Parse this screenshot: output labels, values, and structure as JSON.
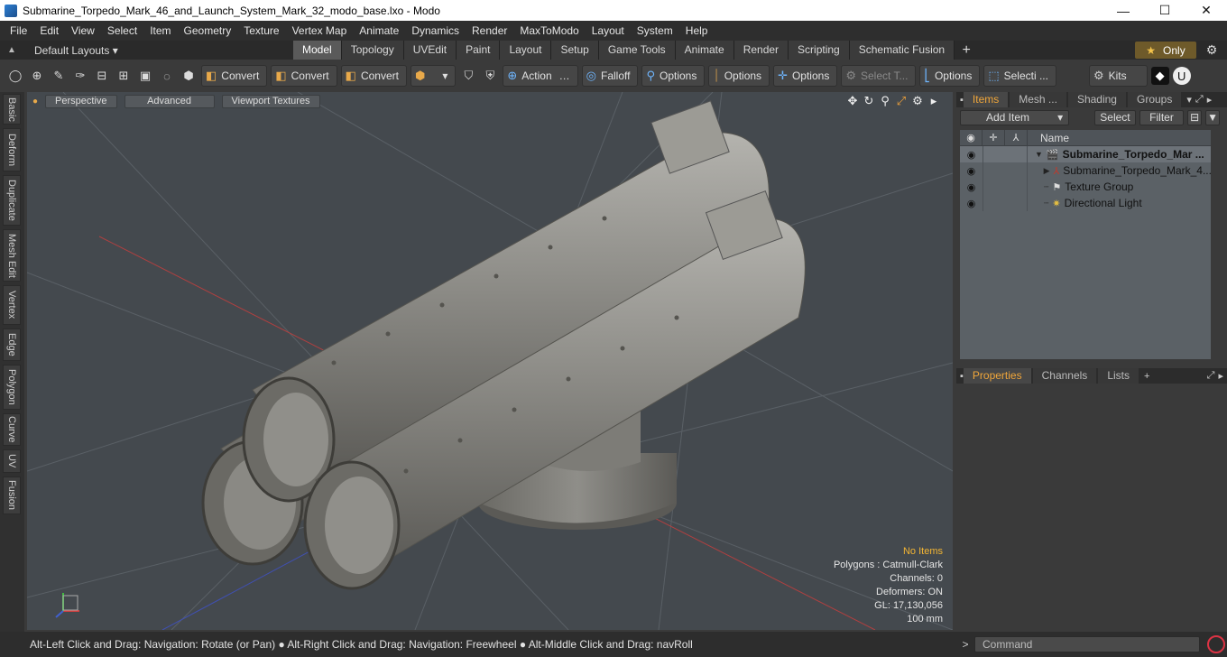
{
  "window": {
    "title": "Submarine_Torpedo_Mark_46_and_Launch_System_Mark_32_modo_base.lxo - Modo",
    "minimize": "—",
    "maximize": "☐",
    "close": "✕"
  },
  "menu": [
    "File",
    "Edit",
    "View",
    "Select",
    "Item",
    "Geometry",
    "Texture",
    "Vertex Map",
    "Animate",
    "Dynamics",
    "Render",
    "MaxToModo",
    "Layout",
    "System",
    "Help"
  ],
  "layouts": {
    "dropdown": "Default Layouts ▾",
    "tabs": [
      "Model",
      "Topology",
      "UVEdit",
      "Paint",
      "Layout",
      "Setup",
      "Game Tools",
      "Animate",
      "Render",
      "Scripting",
      "Schematic Fusion"
    ],
    "active": "Model",
    "only": "Only"
  },
  "toolbar": {
    "convert1": "Convert",
    "convert2": "Convert",
    "convert3": "Convert",
    "action": "Action",
    "falloff": "Falloff",
    "options1": "Options",
    "options2": "Options",
    "options3": "Options",
    "select_t": "Select T...",
    "options4": "Options",
    "selecti": "Selecti ...",
    "kits": "Kits"
  },
  "left_tabs": [
    "Basic",
    "Deform",
    "Duplicate",
    "Mesh Edit",
    "Vertex",
    "Edge",
    "Polygon",
    "Curve",
    "UV",
    "Fusion"
  ],
  "viewport": {
    "perspective": "Perspective",
    "advanced": "Advanced",
    "textures": "Viewport Textures",
    "stats": {
      "no_items": "No Items",
      "polygons": "Polygons : Catmull-Clark",
      "channels": "Channels: 0",
      "deformers": "Deformers: ON",
      "gl": "GL: 17,130,056",
      "scale": "100 mm"
    }
  },
  "items_panel": {
    "tabs": [
      "Items",
      "Mesh ...",
      "Shading",
      "Groups"
    ],
    "add_item": "Add Item",
    "select": "Select",
    "filter": "Filter",
    "name_col": "Name",
    "rows": [
      {
        "label": "Submarine_Torpedo_Mar ...",
        "bold": true
      },
      {
        "label": "Submarine_Torpedo_Mark_4...",
        "bold": false
      },
      {
        "label": "Texture Group",
        "bold": false
      },
      {
        "label": "Directional Light",
        "bold": false
      }
    ]
  },
  "props_panel": {
    "tabs": [
      "Properties",
      "Channels",
      "Lists"
    ]
  },
  "status": {
    "hint": "Alt-Left Click and Drag: Navigation: Rotate (or Pan) ● Alt-Right Click and Drag: Navigation: Freewheel ● Alt-Middle Click and Drag: navRoll",
    "command_placeholder": "Command"
  }
}
